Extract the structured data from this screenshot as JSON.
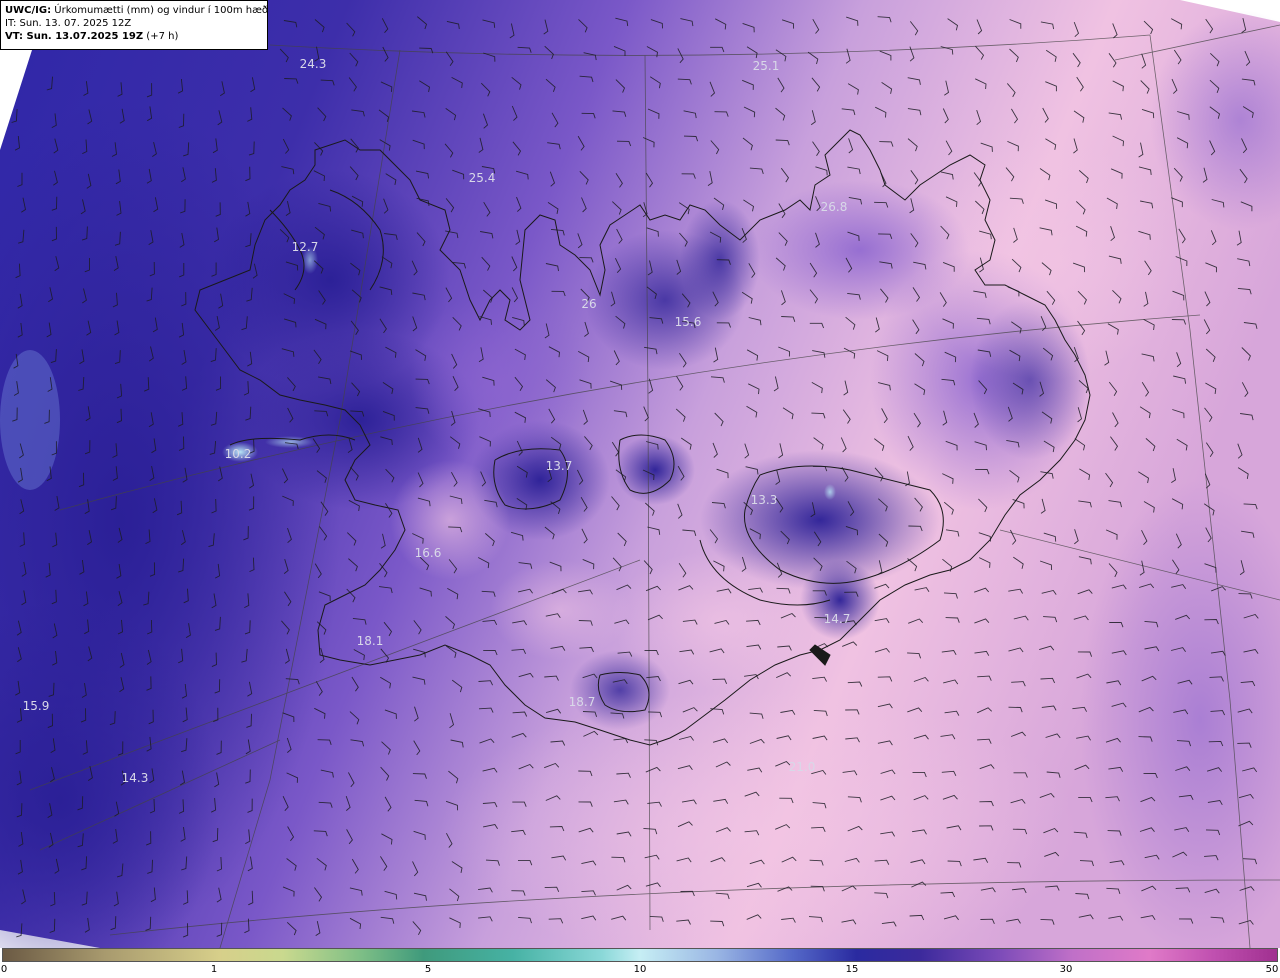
{
  "header": {
    "title_bold": "UWC/IG:",
    "title_rest": " Úrkomumætti (mm) og vindur í 100m hæð",
    "it_line": "IT: Sun. 13. 07. 2025 12Z",
    "vt_bold": "VT: Sun. 13.07.2025 19Z",
    "vt_rest": " (+7 h)"
  },
  "map": {
    "field_colors": {
      "deep": "#3a2ca0",
      "mid": "#6a4cc0",
      "light": "#b58ad8",
      "pale": "#f0c0e0",
      "highlight": "#a0d8f0",
      "coast": "#1a1a1a"
    },
    "value_labels": [
      {
        "text": "24.3"
      },
      {
        "text": "25.1"
      },
      {
        "text": "25.4"
      },
      {
        "text": "26.8"
      },
      {
        "text": "12.7"
      },
      {
        "text": "26"
      },
      {
        "text": "15.6"
      },
      {
        "text": "10.2"
      },
      {
        "text": "13.7"
      },
      {
        "text": "13.3"
      },
      {
        "text": "16.6"
      },
      {
        "text": "18.1"
      },
      {
        "text": "14.7"
      },
      {
        "text": "15.9"
      },
      {
        "text": "18.7"
      },
      {
        "text": "14.3"
      },
      {
        "text": "21.0"
      }
    ]
  },
  "colorbar": {
    "ticks": [
      "0",
      "1",
      "5",
      "10",
      "15",
      "30",
      "50"
    ],
    "tick_positions_value": [
      0,
      1,
      5,
      10,
      15,
      30,
      50
    ]
  }
}
